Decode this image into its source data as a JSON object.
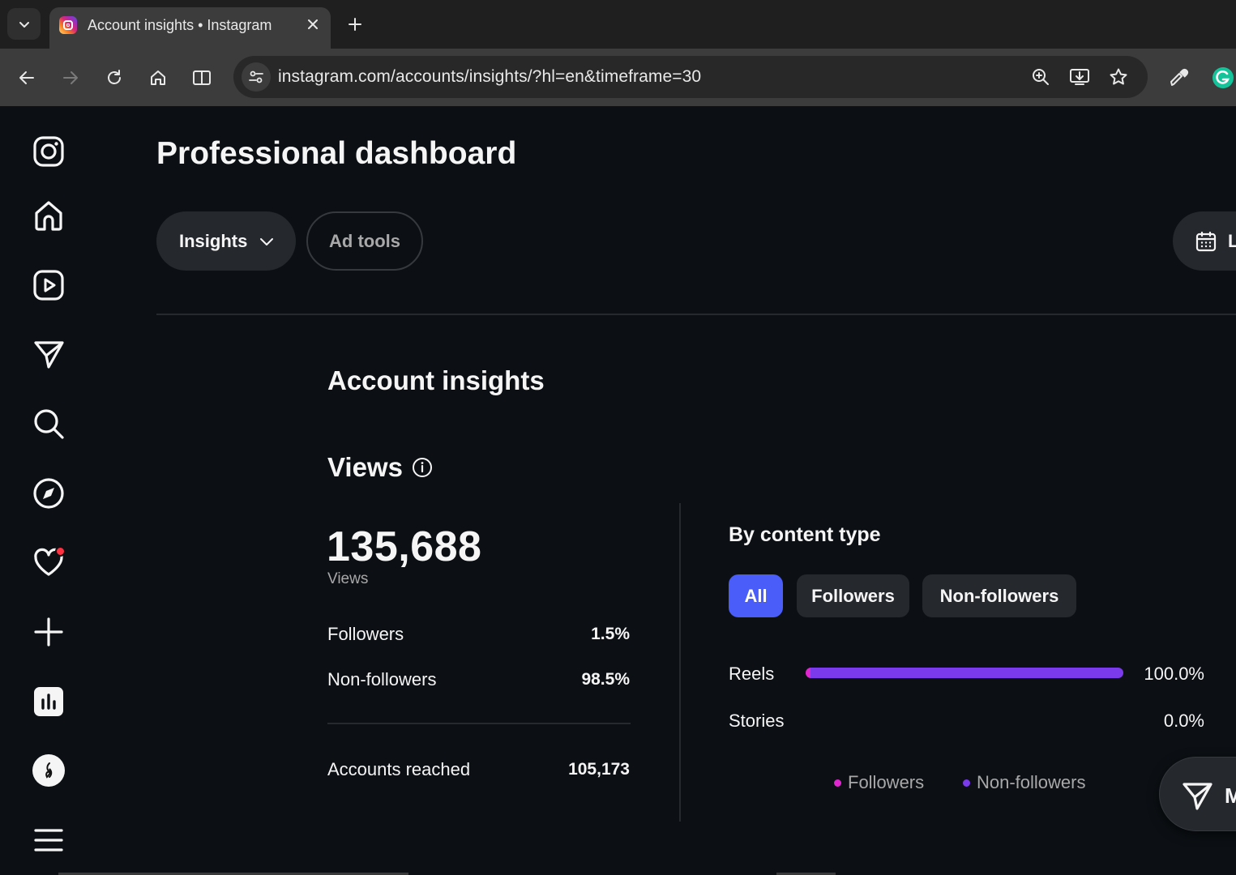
{
  "browser": {
    "tab_title": "Account insights • Instagram",
    "url": "instagram.com/accounts/insights/?hl=en&timeframe=30"
  },
  "sidebar": {
    "items": [
      {
        "icon": "instagram-logo-icon"
      },
      {
        "icon": "home-icon"
      },
      {
        "icon": "reels-icon"
      },
      {
        "icon": "messages-icon"
      },
      {
        "icon": "search-icon"
      },
      {
        "icon": "explore-icon"
      },
      {
        "icon": "notifications-icon"
      },
      {
        "icon": "create-icon"
      },
      {
        "icon": "dashboard-icon"
      },
      {
        "icon": "profile-avatar"
      },
      {
        "icon": "menu-icon"
      }
    ]
  },
  "header": {
    "title": "Professional dashboard",
    "insights_label": "Insights",
    "ad_tools_label": "Ad tools",
    "date_label": "L"
  },
  "insights": {
    "section_title": "Account insights",
    "views_title": "Views",
    "total_views": "135,688",
    "total_views_label": "Views",
    "followers_label": "Followers",
    "followers_value": "1.5%",
    "nonfollowers_label": "Non-followers",
    "nonfollowers_value": "98.5%",
    "accounts_reached_label": "Accounts reached",
    "accounts_reached_value": "105,173"
  },
  "content_type": {
    "title": "By content type",
    "filters": {
      "all": "All",
      "followers": "Followers",
      "nonfollowers": "Non-followers"
    },
    "selected_filter": "All",
    "rows": [
      {
        "label": "Reels",
        "value": "100.0%",
        "followers_fraction": 0.015,
        "nonfollowers_fraction": 0.985
      },
      {
        "label": "Stories",
        "value": "0.0%",
        "followers_fraction": 0,
        "nonfollowers_fraction": 0
      }
    ],
    "legend": {
      "followers": "Followers",
      "nonfollowers": "Non-followers"
    },
    "colors": {
      "followers": "#e026cf",
      "nonfollowers": "#7c3aed",
      "accent": "#4a5df9"
    }
  },
  "messages_fab": {
    "label": "M"
  }
}
